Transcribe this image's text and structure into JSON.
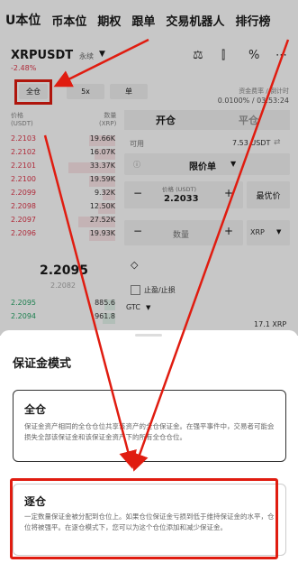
{
  "nav": {
    "tabs": [
      "U本位",
      "币本位",
      "期权",
      "跟单",
      "交易机器人",
      "排行榜"
    ]
  },
  "header": {
    "pair": "XRPUSDT",
    "perp": "永续",
    "change": "-2.48%"
  },
  "modes": {
    "cross": "全仓",
    "leverage": "5x",
    "single": "单"
  },
  "funding": {
    "label": "资金费率 / 倒计时",
    "value": "0.0100% / 03:53:24"
  },
  "book": {
    "price_header": "价格\n(USDT)",
    "qty_header": "数量\n(XRP)",
    "sell": [
      {
        "price": "2.2103",
        "qty": "19.66K",
        "depth": 0.25
      },
      {
        "price": "2.2102",
        "qty": "16.07K",
        "depth": 0.2
      },
      {
        "price": "2.2101",
        "qty": "33.37K",
        "depth": 0.45
      },
      {
        "price": "2.2100",
        "qty": "19.59K",
        "depth": 0.25
      },
      {
        "price": "2.2099",
        "qty": "9.32K",
        "depth": 0.12
      },
      {
        "price": "2.2098",
        "qty": "12.50K",
        "depth": 0.16
      },
      {
        "price": "2.2097",
        "qty": "27.52K",
        "depth": 0.35
      },
      {
        "price": "2.2096",
        "qty": "19.93K",
        "depth": 0.25
      }
    ],
    "mid_price": "2.2095",
    "mid_sub": "2.2082",
    "buy": [
      {
        "price": "2.2095",
        "qty": "885.6",
        "depth": 0.1
      },
      {
        "price": "2.2094",
        "qty": "961.8",
        "depth": 0.12
      }
    ]
  },
  "panel": {
    "open": "开仓",
    "close": "平仓",
    "avail_label": "可用",
    "avail_value": "7.53 USDT",
    "order_type": "限价单",
    "price_label": "价格 (USDT)",
    "price_value": "2.2033",
    "best_price": "最优价",
    "qty_label": "数量",
    "qty_unit": "XRP",
    "tpsl": "止盈/止损",
    "tif": "GTC",
    "bottom_value": "17.1 XRP"
  },
  "sheet": {
    "title": "保证金模式",
    "cross_title": "全仓",
    "cross_desc": "保证金资产相同的全仓仓位共享该资产的全仓保证金。在强平事件中，交易者可能会损失全部该保证金和该保证金资产下的所有全仓仓位。",
    "isolated_title": "逐仓",
    "isolated_desc": "一定数量保证金被分配到仓位上。如果仓位保证金亏损到低于维持保证金的水平，仓位将被强平。在逐仓模式下，您可以为这个仓位添加和减少保证金。"
  },
  "colors": {
    "sell": "#e0364a",
    "buy": "#27a567",
    "highlight": "#e01c10"
  }
}
